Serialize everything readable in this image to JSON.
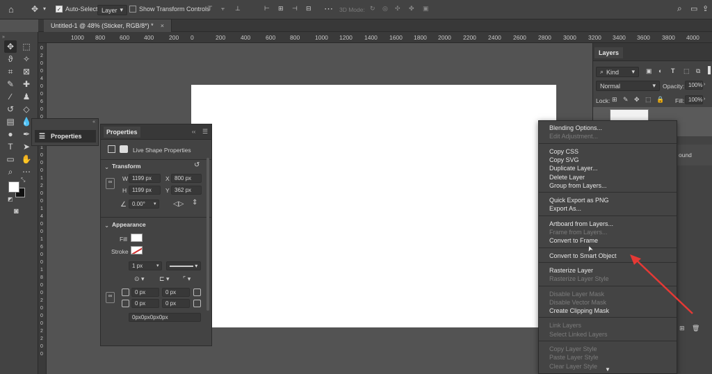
{
  "options_bar": {
    "auto_select_label": "Auto-Select:",
    "auto_select_value": "Layer",
    "show_transform_label": "Show Transform Controls",
    "mode_3d_label": "3D Mode:"
  },
  "document_tab": {
    "title": "Untitled-1 @ 48% (Sticker, RGB/8*) *",
    "close": "×"
  },
  "ruler_h": [
    "1000",
    "800",
    "600",
    "400",
    "200",
    "0",
    "200",
    "400",
    "600",
    "800",
    "1000",
    "1200",
    "1400",
    "1600",
    "1800",
    "2000",
    "2200",
    "2400",
    "2600",
    "2800",
    "3000",
    "3200",
    "3400",
    "3600",
    "3800",
    "4000"
  ],
  "ruler_v": [
    "0",
    "2",
    "0",
    "0",
    "4",
    "0",
    "0",
    "6",
    "0",
    "0",
    "8",
    "0",
    "0",
    "1",
    "0",
    "0",
    "0",
    "1",
    "2",
    "0",
    "0",
    "1",
    "4",
    "0",
    "0",
    "1",
    "6",
    "0",
    "0",
    "1",
    "8",
    "0",
    "0",
    "2",
    "0",
    "0",
    "0",
    "2",
    "2",
    "0",
    "0"
  ],
  "properties_collapsed": {
    "label": "Properties"
  },
  "properties": {
    "title": "Properties",
    "shape_type": "Live Shape Properties",
    "transform": {
      "heading": "Transform",
      "w_label": "W",
      "w_value": "1199 px",
      "x_label": "X",
      "x_value": "800 px",
      "h_label": "H",
      "h_value": "1199 px",
      "y_label": "Y",
      "y_value": "362 px",
      "angle_value": "0.00°"
    },
    "appearance": {
      "heading": "Appearance",
      "fill_label": "Fill",
      "stroke_label": "Stroke",
      "stroke_width": "1 px",
      "corner_tl": "0 px",
      "corner_tr": "0 px",
      "corner_bl": "0 px",
      "corner_br": "0 px",
      "corners_combined": "0px0px0px0px"
    }
  },
  "layers": {
    "title": "Layers",
    "filter_kind": "Kind",
    "blend_mode": "Normal",
    "opacity_label": "Opacity:",
    "opacity_value": "100%",
    "lock_label": "Lock:",
    "fill_label": "Fill:",
    "fill_value": "100%",
    "layer_name_partial": "ound"
  },
  "context_menu": {
    "groups": [
      [
        {
          "label": "Blending Options...",
          "enabled": true
        },
        {
          "label": "Edit Adjustment...",
          "enabled": false
        }
      ],
      [
        {
          "label": "Copy CSS",
          "enabled": true
        },
        {
          "label": "Copy SVG",
          "enabled": true
        },
        {
          "label": "Duplicate Layer...",
          "enabled": true
        },
        {
          "label": "Delete Layer",
          "enabled": true
        },
        {
          "label": "Group from Layers...",
          "enabled": true
        }
      ],
      [
        {
          "label": "Quick Export as PNG",
          "enabled": true
        },
        {
          "label": "Export As...",
          "enabled": true
        }
      ],
      [
        {
          "label": "Artboard from Layers...",
          "enabled": true
        },
        {
          "label": "Frame from Layers...",
          "enabled": false
        },
        {
          "label": "Convert to Frame",
          "enabled": true
        }
      ],
      [
        {
          "label": "Convert to Smart Object",
          "enabled": true
        }
      ],
      [
        {
          "label": "Rasterize Layer",
          "enabled": true
        },
        {
          "label": "Rasterize Layer Style",
          "enabled": false
        }
      ],
      [
        {
          "label": "Disable Layer Mask",
          "enabled": false
        },
        {
          "label": "Disable Vector Mask",
          "enabled": false
        },
        {
          "label": "Create Clipping Mask",
          "enabled": true
        }
      ],
      [
        {
          "label": "Link Layers",
          "enabled": false
        },
        {
          "label": "Select Linked Layers",
          "enabled": false
        }
      ],
      [
        {
          "label": "Copy Layer Style",
          "enabled": false
        },
        {
          "label": "Paste Layer Style",
          "enabled": false
        },
        {
          "label": "Clear Layer Style",
          "enabled": false
        }
      ]
    ]
  },
  "colors": {
    "ui_bg": "#535353",
    "panel": "#434343",
    "annotation_arrow": "#e53935"
  },
  "icons": [
    "home-icon",
    "move-icon",
    "align-icon",
    "more-icon",
    "search-icon",
    "workspace-icon",
    "share-icon"
  ]
}
